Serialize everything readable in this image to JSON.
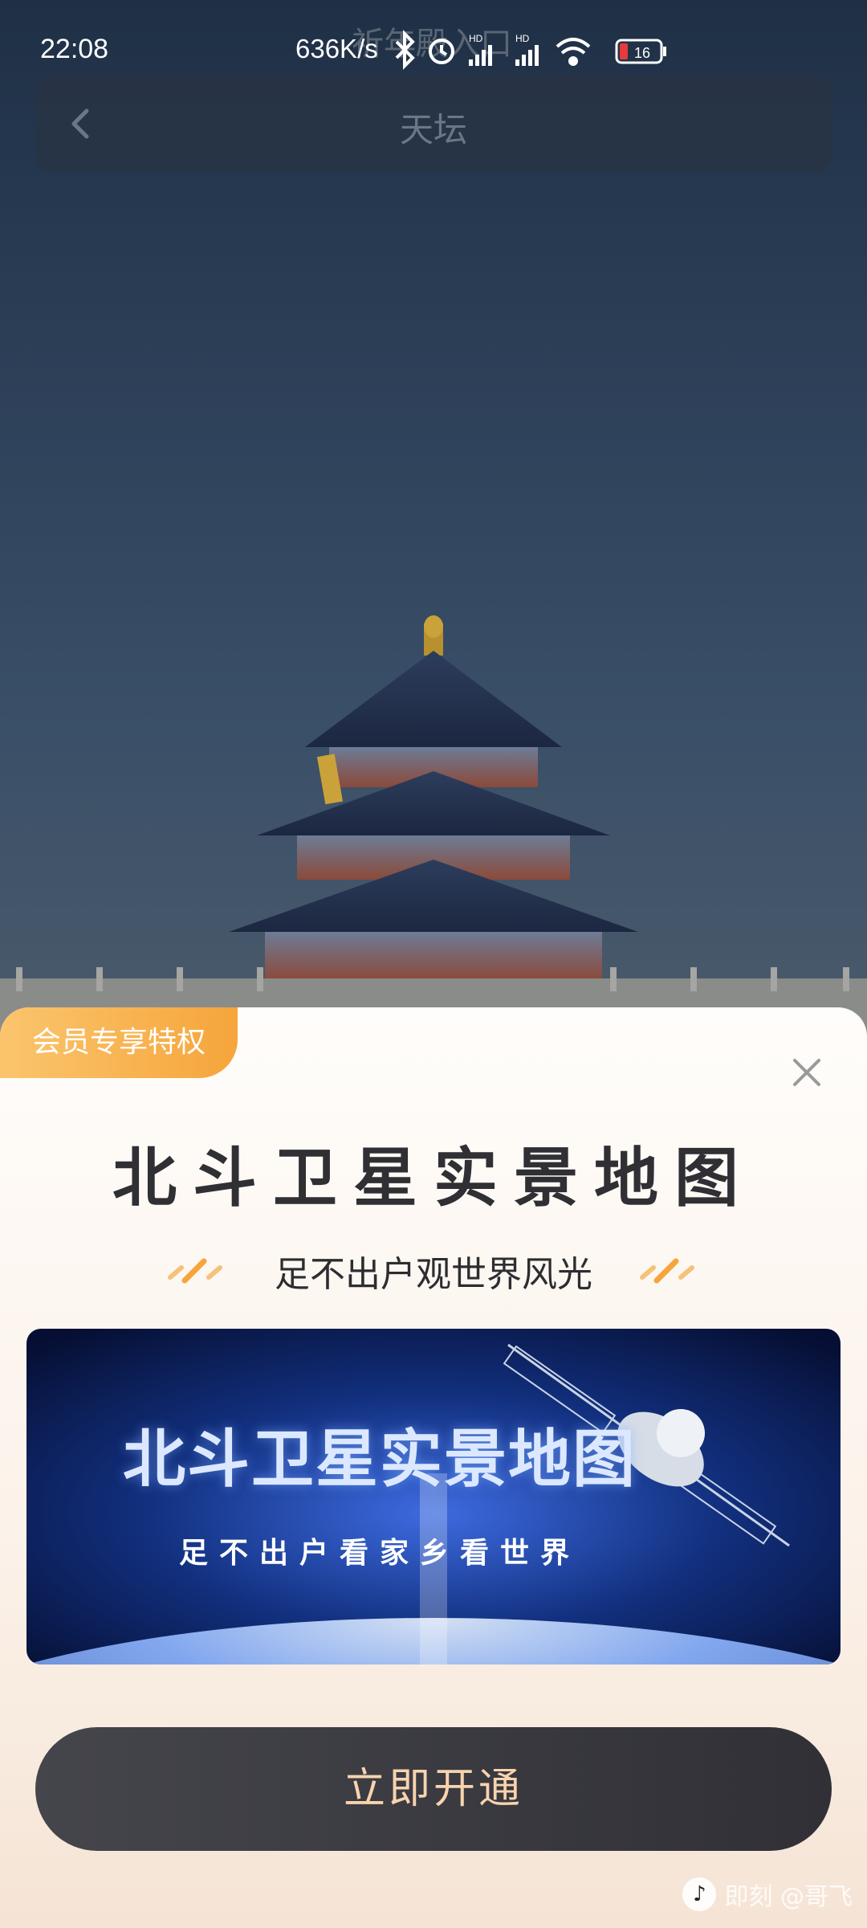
{
  "status_bar": {
    "time": "22:08",
    "network_speed": "636K/s",
    "battery": "16",
    "faint_text": "祈年殿入口"
  },
  "nav": {
    "title": "天坛"
  },
  "sheet": {
    "badge": "会员专享特权",
    "headline": "北斗卫星实景地图",
    "subline": "足不出户观世界风光",
    "banner": {
      "title": "北斗卫星实景地图",
      "subtitle": "足不出户看家乡看世界"
    },
    "cta": "立即开通"
  },
  "watermark": {
    "app": "即刻",
    "user": "@哥飞"
  },
  "colors": {
    "badge": "#f6a53b",
    "cta_bg": "#3a3a40",
    "cta_text": "#f8d3ad"
  },
  "icons": [
    "back-chevron-icon",
    "close-icon",
    "bluetooth-icon",
    "alarm-icon",
    "signal-icon",
    "wifi-icon",
    "battery-icon"
  ]
}
